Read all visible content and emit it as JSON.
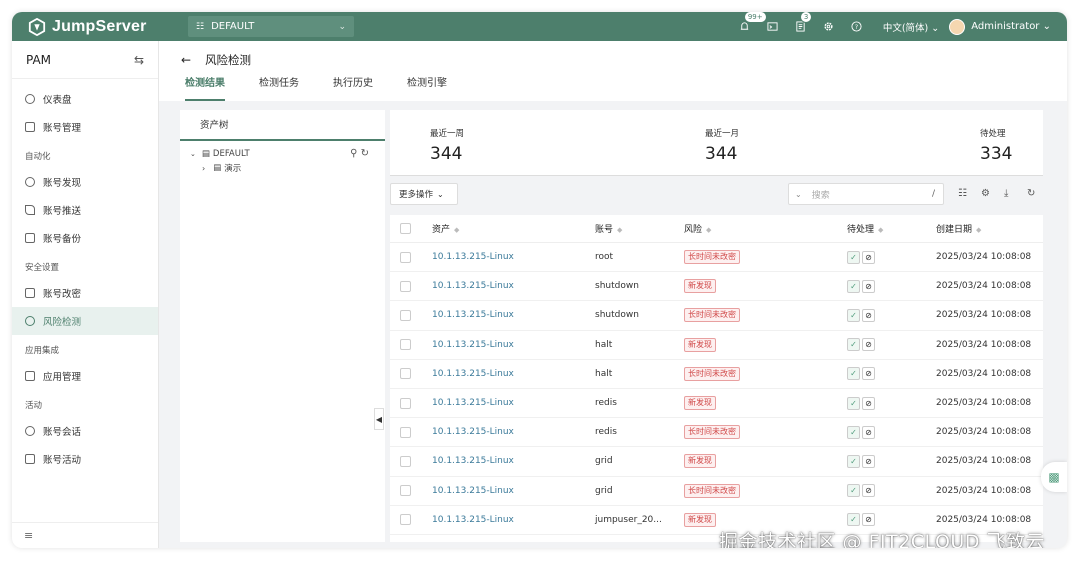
{
  "header": {
    "brand": "JumpServer",
    "org": "DEFAULT",
    "notify_badge": "99+",
    "tickets_badge": "3",
    "language": "中文(简体)",
    "user": "Administrator",
    "accent": "#4d7f6c"
  },
  "sidebar": {
    "title": "PAM",
    "items": [
      {
        "label": "仪表盘",
        "icon": "dashboard-icon"
      },
      {
        "label": "账号管理",
        "icon": "lock-icon"
      }
    ],
    "group_automation": "自动化",
    "automation_items": [
      {
        "label": "账号发现",
        "icon": "search-icon"
      },
      {
        "label": "账号推送",
        "icon": "send-icon"
      },
      {
        "label": "账号备份",
        "icon": "backup-icon"
      }
    ],
    "group_security": "安全设置",
    "security_items": [
      {
        "label": "账号改密",
        "icon": "key-icon"
      },
      {
        "label": "风险检测",
        "icon": "radar-icon"
      }
    ],
    "group_apps": "应用集成",
    "apps_items": [
      {
        "label": "应用管理",
        "icon": "apps-icon"
      }
    ],
    "group_activity": "活动",
    "activity_items": [
      {
        "label": "账号会话",
        "icon": "link-icon"
      },
      {
        "label": "账号活动",
        "icon": "calendar-icon"
      }
    ]
  },
  "page": {
    "title": "风险检测",
    "tabs": [
      "检测结果",
      "检测任务",
      "执行历史",
      "检测引擎"
    ]
  },
  "tree": {
    "title": "资产树",
    "root": "DEFAULT",
    "child": "演示"
  },
  "stats": [
    {
      "label": "最近一周",
      "value": "344"
    },
    {
      "label": "最近一月",
      "value": "344"
    },
    {
      "label": "待处理",
      "value": "334"
    }
  ],
  "toolbar": {
    "more": "更多操作",
    "search_placeholder": "搜索",
    "slash": "/"
  },
  "table": {
    "headers": [
      "资产",
      "账号",
      "风险",
      "待处理",
      "创建日期"
    ],
    "rows": [
      {
        "asset": "10.1.13.215-Linux",
        "account": "root",
        "risk": "长时间未改密",
        "date": "2025/03/24 10:08:08"
      },
      {
        "asset": "10.1.13.215-Linux",
        "account": "shutdown",
        "risk": "新发现",
        "date": "2025/03/24 10:08:08"
      },
      {
        "asset": "10.1.13.215-Linux",
        "account": "shutdown",
        "risk": "长时间未改密",
        "date": "2025/03/24 10:08:08"
      },
      {
        "asset": "10.1.13.215-Linux",
        "account": "halt",
        "risk": "新发现",
        "date": "2025/03/24 10:08:08"
      },
      {
        "asset": "10.1.13.215-Linux",
        "account": "halt",
        "risk": "长时间未改密",
        "date": "2025/03/24 10:08:08"
      },
      {
        "asset": "10.1.13.215-Linux",
        "account": "redis",
        "risk": "新发现",
        "date": "2025/03/24 10:08:08"
      },
      {
        "asset": "10.1.13.215-Linux",
        "account": "redis",
        "risk": "长时间未改密",
        "date": "2025/03/24 10:08:08"
      },
      {
        "asset": "10.1.13.215-Linux",
        "account": "grid",
        "risk": "新发现",
        "date": "2025/03/24 10:08:08"
      },
      {
        "asset": "10.1.13.215-Linux",
        "account": "grid",
        "risk": "长时间未改密",
        "date": "2025/03/24 10:08:08"
      },
      {
        "asset": "10.1.13.215-Linux",
        "account": "jumpuser_20...",
        "risk": "新发现",
        "date": "2025/03/24 10:08:08"
      }
    ]
  },
  "watermark": "掘金技术社区 @ FIT2CLOUD 飞致云"
}
